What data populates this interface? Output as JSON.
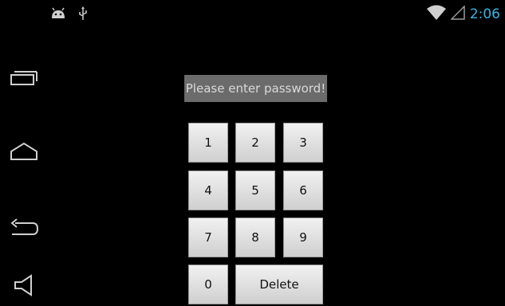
{
  "status_bar": {
    "time": "2:06",
    "icons": [
      "android-icon",
      "usb-icon",
      "wifi-icon",
      "signal-icon"
    ]
  },
  "nav_bar": {
    "buttons": [
      "recent-apps-icon",
      "home-icon",
      "back-icon",
      "volume-icon"
    ]
  },
  "prompt": {
    "text": "Please enter password!"
  },
  "keypad": {
    "k1": "1",
    "k2": "2",
    "k3": "3",
    "k4": "4",
    "k5": "5",
    "k6": "6",
    "k7": "7",
    "k8": "8",
    "k9": "9",
    "k0": "0",
    "delete": "Delete"
  },
  "colors": {
    "background": "#000000",
    "clock": "#33b5e5",
    "prompt_bg": "#6b6b6b"
  }
}
